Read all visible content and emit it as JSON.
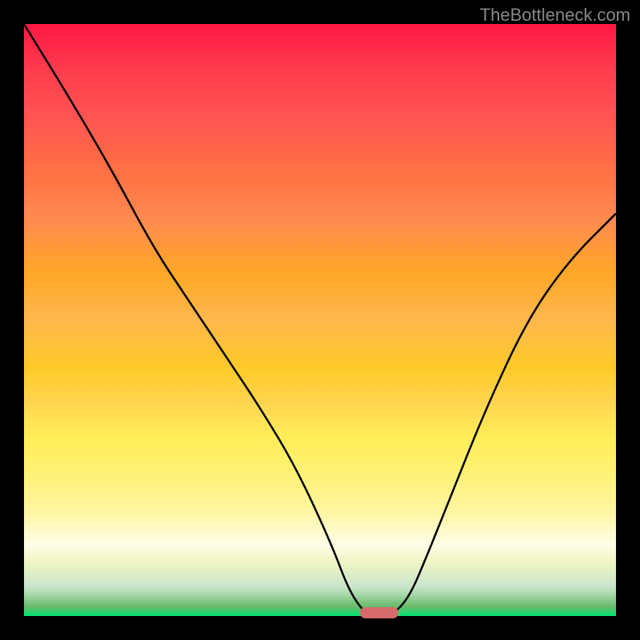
{
  "watermark": "TheBottleneck.com",
  "chart_data": {
    "type": "line",
    "title": "",
    "xlabel": "",
    "ylabel": "",
    "xlim": [
      0,
      100
    ],
    "ylim": [
      0,
      100
    ],
    "series": [
      {
        "name": "bottleneck-curve",
        "x": [
          0,
          8,
          15,
          22,
          28,
          34,
          40,
          46,
          52,
          55,
          58,
          60,
          62,
          65,
          68,
          72,
          78,
          85,
          92,
          100
        ],
        "values": [
          100,
          87,
          75,
          62,
          53,
          44,
          35,
          25,
          12,
          4,
          0,
          0,
          0,
          3,
          10,
          20,
          35,
          50,
          60,
          68
        ]
      }
    ],
    "marker": {
      "x_center_pct": 60,
      "width_pct": 6.5,
      "color": "#d56b6b"
    },
    "gradient_stops": [
      {
        "pos": 0,
        "color": "#ff1744"
      },
      {
        "pos": 50,
        "color": "#ffca28"
      },
      {
        "pos": 88,
        "color": "#fffde7"
      },
      {
        "pos": 100,
        "color": "#00e676"
      }
    ]
  }
}
